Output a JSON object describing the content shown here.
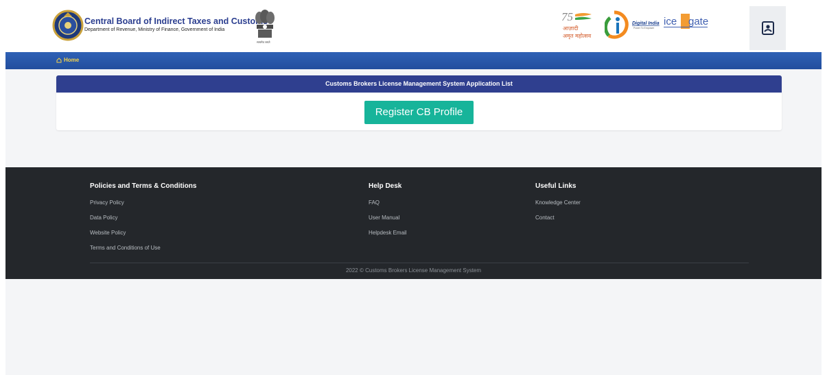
{
  "header": {
    "org_title": "Central Board of Indirect Taxes and Customs",
    "org_subtitle": "Department of Revenue, Ministry of Finance, Government of India",
    "emblem_caption": "सत्यमेव जयते",
    "logos": [
      "cbic-emblem-icon",
      "ashoka-emblem-icon",
      "azadi-ka-amrit-mahotsav-logo",
      "digital-india-logo",
      "icegate-logo"
    ],
    "azadi_text": "आज़ादी का अमृत महोत्सव",
    "digital_india_text": "Digital India",
    "digital_india_tag": "Power To Empower",
    "icegate_text": "icegate",
    "user_icon": "user-badge-icon"
  },
  "nav": {
    "home_icon": "home-icon",
    "home_label": "Home"
  },
  "card": {
    "title": "Customs Brokers License Management System Application List",
    "register_button": "Register CB Profile"
  },
  "footer": {
    "columns": [
      {
        "heading": "Policies and Terms & Conditions",
        "links": [
          "Privacy Policy",
          "Data Policy",
          "Website Policy",
          "Terms and Conditions of Use"
        ]
      },
      {
        "heading": "Help Desk",
        "links": [
          "FAQ",
          "User Manual",
          "Helpdesk Email"
        ]
      },
      {
        "heading": "Useful Links",
        "links": [
          "Knowledge Center",
          "Contact"
        ]
      }
    ],
    "copyright": "2022 © Customs Brokers License Management System"
  },
  "colors": {
    "navbar": "#2f61b5",
    "card_header": "#2f3f8f",
    "button": "#17b49a",
    "footer": "#24272b",
    "home_link": "#f7d44a"
  }
}
